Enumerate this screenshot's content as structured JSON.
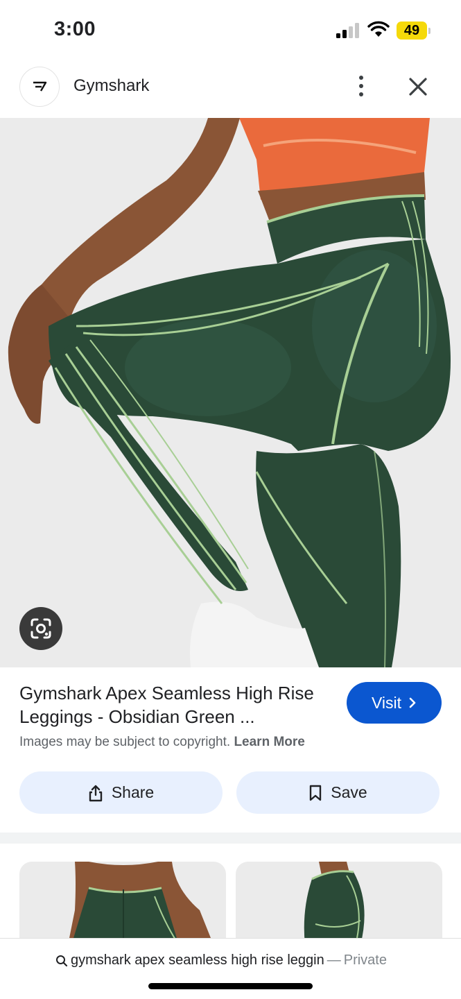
{
  "status_bar": {
    "time": "3:00",
    "battery": "49",
    "icons": [
      "cellular-signal-icon",
      "wifi-icon",
      "battery-icon"
    ]
  },
  "site_header": {
    "site_name": "Gymshark",
    "favicon": "gymshark-logo-icon",
    "more_icon": "more-vert-icon",
    "close_icon": "close-icon"
  },
  "hero": {
    "lens_icon": "google-lens-icon",
    "colors": {
      "background": "#ebebeb",
      "leggings": "#2a4a37",
      "leggings_stripe": "#a8cf95",
      "sports_bra": "#ea6a3c",
      "skin": "#8a5536"
    }
  },
  "result": {
    "title": "Gymshark Apex Seamless High Rise Leggings - Obsidian Green ...",
    "visit_label": "Visit",
    "visit_icon": "chevron-right-icon",
    "copyright_text": "Images may be subject to copyright.",
    "learn_more": "Learn More"
  },
  "actions": {
    "share_label": "Share",
    "share_icon": "share-icon",
    "save_label": "Save",
    "save_icon": "bookmark-icon"
  },
  "url_bar": {
    "query": "gymshark apex seamless high rise leggin",
    "separator": "—",
    "mode": "Private",
    "search_icon": "search-icon"
  },
  "colors": {
    "accent": "#0b57d0",
    "chip_bg": "#e8f0fe",
    "text_secondary": "#5f6368"
  }
}
